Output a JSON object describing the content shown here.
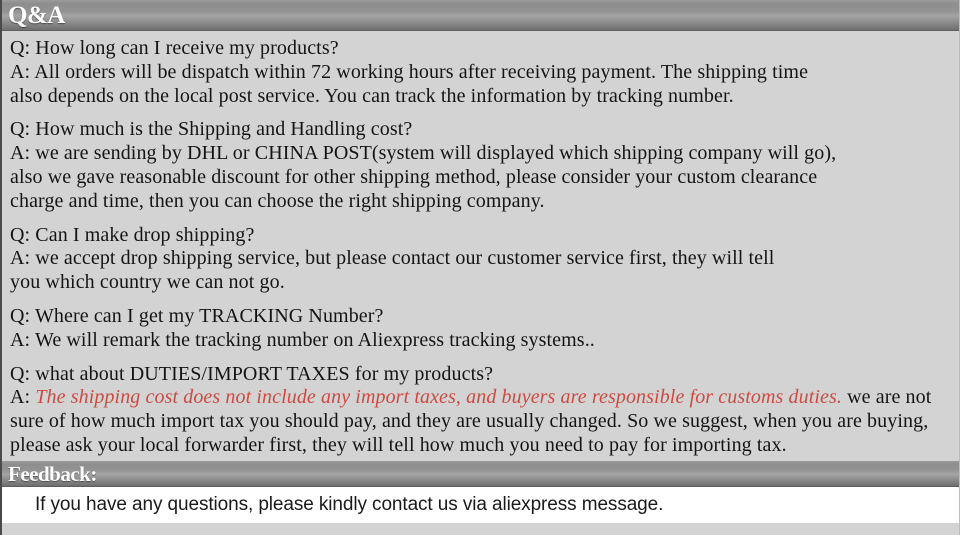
{
  "sections": {
    "qa": {
      "title": "Q&A",
      "blocks": [
        {
          "lines": [
            "Q: How long can I receive my products?",
            "A: All orders will be dispatch within 72 working hours after receiving payment. The shipping time",
            "also depends on the local post service. You can track the information by tracking number."
          ]
        },
        {
          "lines": [
            "Q: How much is the Shipping and Handling cost?",
            "A: we are sending by DHL or CHINA POST(system will displayed which shipping company will go),",
            "also we gave reasonable discount for other shipping method, please consider your custom clearance",
            "charge and time, then you can choose the right shipping company."
          ]
        },
        {
          "lines": [
            "Q: Can I make drop shipping?",
            "A: we accept drop shipping service, but please contact our customer service first, they will tell",
            "you which country we can not go."
          ]
        },
        {
          "lines": [
            "Q: Where can I get my TRACKING Number?",
            "A: We will remark the tracking number on Aliexpress tracking systems.."
          ]
        },
        {
          "lines": [
            "Q: what about DUTIES/IMPORT TAXES for my products?"
          ],
          "answer_prefix": "A: ",
          "answer_highlight": "The shipping cost does not include any import taxes, and buyers are responsible for customs duties.",
          "answer_rest": " we are not sure of how much import tax you should pay, and they are usually changed. So we suggest, when you are buying, please ask your local forwarder first, they will tell how much you need to pay for importing tax."
        }
      ]
    },
    "feedback": {
      "title": "Feedback:",
      "text": "If you have any questions, please kindly contact us via aliexpress message."
    }
  },
  "colors": {
    "page_background": "#d3d3d3",
    "bar_text": "#ffffff",
    "body_text": "#141414",
    "highlight_red": "#cb4b42",
    "feedback_background": "#ffffff"
  }
}
